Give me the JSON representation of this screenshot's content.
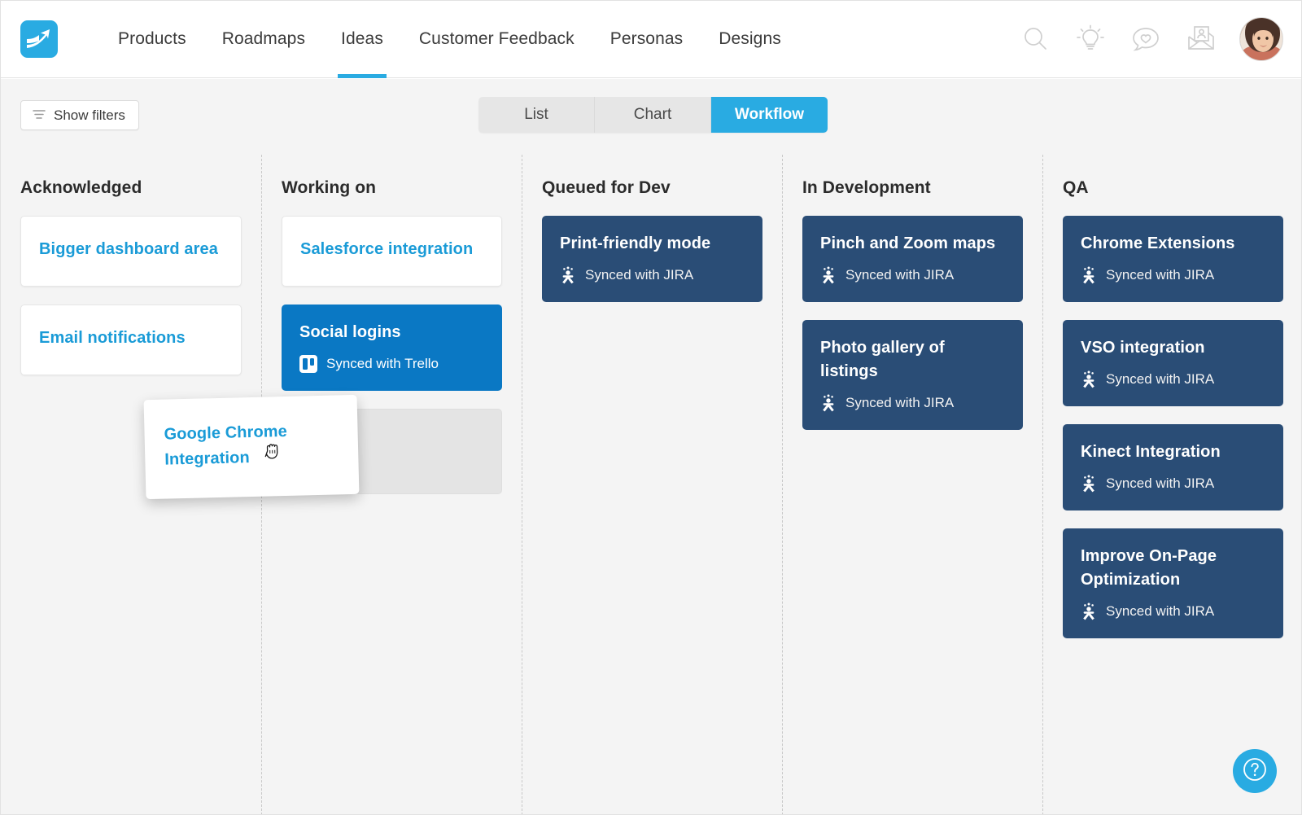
{
  "nav": {
    "logo_icon": "aha-arrow-logo",
    "links": [
      {
        "label": "Products",
        "active": false
      },
      {
        "label": "Roadmaps",
        "active": false
      },
      {
        "label": "Ideas",
        "active": true
      },
      {
        "label": "Customer Feedback",
        "active": false
      },
      {
        "label": "Personas",
        "active": false
      },
      {
        "label": "Designs",
        "active": false
      }
    ],
    "icons": [
      {
        "name": "search-icon"
      },
      {
        "name": "lightbulb-icon"
      },
      {
        "name": "chat-heart-icon"
      },
      {
        "name": "envelope-person-icon"
      }
    ],
    "avatar_name": "user-avatar"
  },
  "toolbar": {
    "show_filters_label": "Show filters",
    "filter_icon": "filter-icon",
    "view_tabs": [
      {
        "label": "List",
        "active": false
      },
      {
        "label": "Chart",
        "active": false
      },
      {
        "label": "Workflow",
        "active": true
      }
    ]
  },
  "board": {
    "columns": [
      {
        "title": "Acknowledged",
        "cards": [
          {
            "title": "Bigger dashboard area",
            "style": "white",
            "sync": null
          },
          {
            "title": "Email notifications",
            "style": "white",
            "sync": null
          }
        ]
      },
      {
        "title": "Working on",
        "cards": [
          {
            "title": "Salesforce integration",
            "style": "white",
            "sync": null
          },
          {
            "title": "Social logins",
            "style": "blue",
            "sync": "Synced with Trello",
            "sync_icon": "trello-icon"
          },
          {
            "title": "",
            "style": "placeholder",
            "sync": null
          }
        ]
      },
      {
        "title": "Queued for Dev",
        "cards": [
          {
            "title": "Print-friendly mode",
            "style": "navy",
            "sync": "Synced with JIRA",
            "sync_icon": "jira-icon"
          }
        ]
      },
      {
        "title": "In Development",
        "cards": [
          {
            "title": "Pinch and Zoom maps",
            "style": "navy",
            "sync": "Synced with JIRA",
            "sync_icon": "jira-icon"
          },
          {
            "title": "Photo gallery of listings",
            "style": "navy",
            "sync": "Synced with JIRA",
            "sync_icon": "jira-icon"
          }
        ]
      },
      {
        "title": "QA",
        "cards": [
          {
            "title": "Chrome Extensions",
            "style": "navy",
            "sync": "Synced with JIRA",
            "sync_icon": "jira-icon"
          },
          {
            "title": "VSO integration",
            "style": "navy",
            "sync": "Synced with JIRA",
            "sync_icon": "jira-icon"
          },
          {
            "title": "Kinect Integration",
            "style": "navy",
            "sync": "Synced with JIRA",
            "sync_icon": "jira-icon"
          },
          {
            "title": "Improve On-Page Optimization",
            "style": "navy",
            "sync": "Synced with JIRA",
            "sync_icon": "jira-icon"
          }
        ]
      }
    ]
  },
  "drag": {
    "title": "Google Chrome Integration",
    "cursor_icon": "grab-hand-cursor"
  },
  "help": {
    "icon": "question-mark-icon",
    "label": "?"
  },
  "colors": {
    "accent": "#29abe2",
    "card_blue": "#0a78c4",
    "card_navy": "#2a4d76",
    "link_blue": "#1a9bd7",
    "page_bg": "#f4f4f4"
  }
}
